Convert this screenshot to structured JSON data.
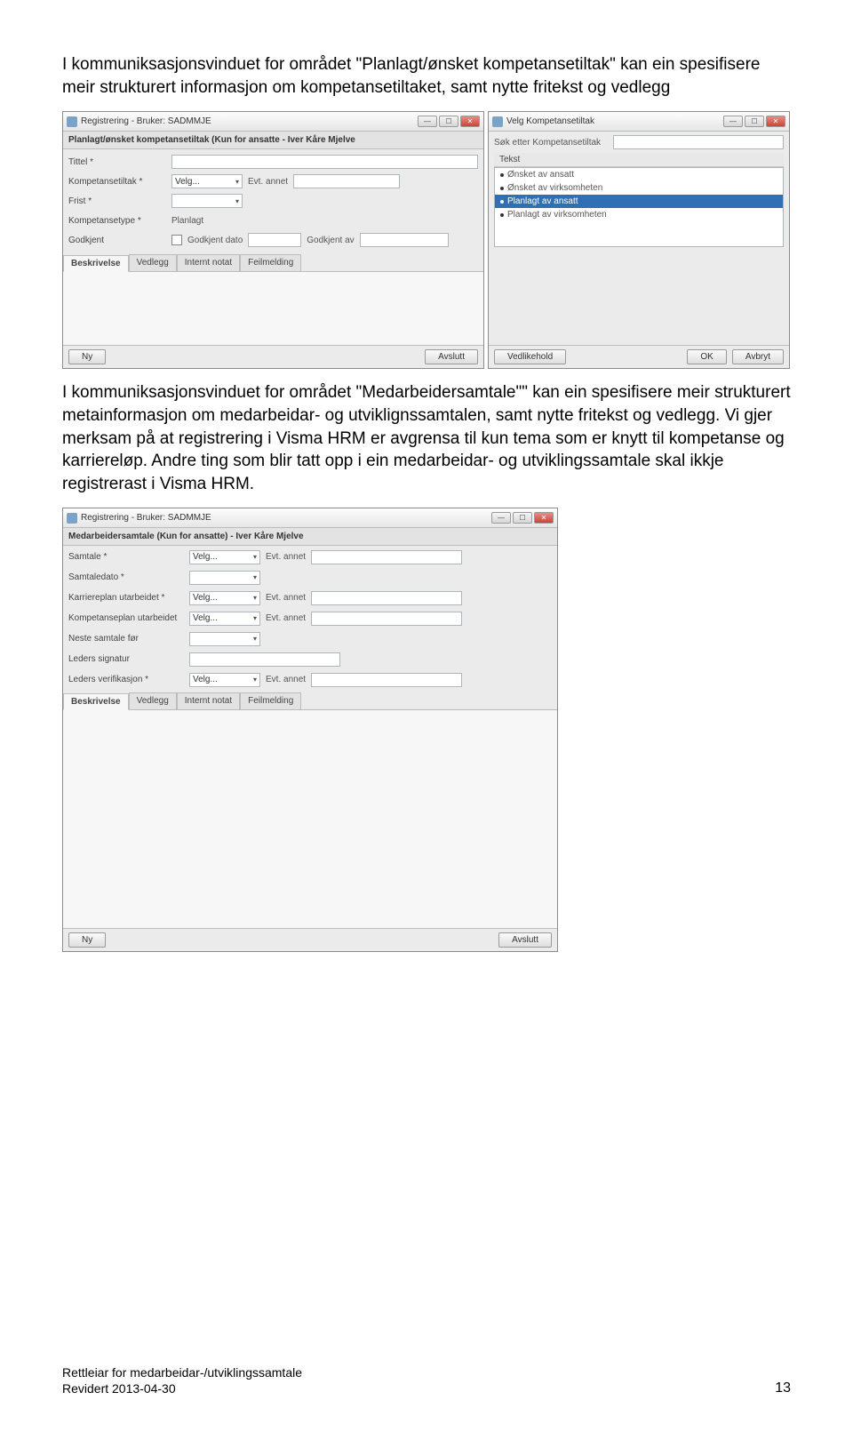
{
  "para1": "I kommuniksasjonsvinduet for området \"Planlagt/ønsket kompetansetiltak\" kan ein spesifisere meir strukturert informasjon om kompetansetiltaket, samt nytte fritekst og vedlegg",
  "para2": "I kommuniksasjonsvinduet for området \"Medarbeidersamtale\"\" kan ein spesifisere meir strukturert metainformasjon om medarbeidar- og utviklignssamtalen, samt nytte fritekst og vedlegg. Vi gjer merksam på at registrering i Visma HRM er avgrensa til kun tema som er knytt til kompetanse og karriereløp. Andre ting som blir tatt opp i ein medarbeidar- og utviklingssamtale skal ikkje registrerast i Visma HRM.",
  "win1": {
    "title": "Registrering - Bruker: SADMMJE",
    "subheader": "Planlagt/ønsket kompetansetiltak (Kun for ansatte - Iver Kåre Mjelve",
    "labels": {
      "tittel": "Tittel *",
      "kompetansetiltak": "Kompetansetiltak *",
      "frist": "Frist *",
      "kompetansetype": "Kompetansetype *",
      "godkjent": "Godkjent"
    },
    "velg": "Velg...",
    "evtannet": "Evt. annet",
    "planlagt": "Planlagt",
    "godkjentdato": "Godkjent dato",
    "godkjentav": "Godkjent av",
    "tabs": [
      "Beskrivelse",
      "Vedlegg",
      "Internt notat",
      "Feilmelding"
    ],
    "btn_ny": "Ny",
    "btn_avslutt": "Avslutt"
  },
  "win2": {
    "title": "Velg Kompetansetiltak",
    "search_label": "Søk etter Kompetansetiltak",
    "listhead": "Tekst",
    "items": [
      "Ønsket av ansatt",
      "Ønsket av virksomheten",
      "Planlagt av ansatt",
      "Planlagt av virksomheten"
    ],
    "selected_index": 2,
    "btn_vedlikehold": "Vedlikehold",
    "btn_ok": "OK",
    "btn_avbryt": "Avbryt"
  },
  "win3": {
    "title": "Registrering - Bruker: SADMMJE",
    "subheader": "Medarbeidersamtale (Kun for ansatte) - Iver Kåre Mjelve",
    "labels": {
      "samtale": "Samtale *",
      "samtaledato": "Samtaledato *",
      "karriereplan": "Karriereplan utarbeidet *",
      "kompetanseplan": "Kompetanseplan utarbeidet",
      "neste": "Neste samtale før",
      "lederssign": "Leders signatur",
      "ledersverif": "Leders verifikasjon *"
    },
    "velg": "Velg...",
    "evtannet": "Evt. annet",
    "tabs": [
      "Beskrivelse",
      "Vedlegg",
      "Internt notat",
      "Feilmelding"
    ],
    "btn_ny": "Ny",
    "btn_avslutt": "Avslutt"
  },
  "footer": {
    "line1": "Rettleiar for medarbeidar-/utviklingssamtale",
    "line2": "Revidert 2013-04-30",
    "pagenum": "13"
  }
}
